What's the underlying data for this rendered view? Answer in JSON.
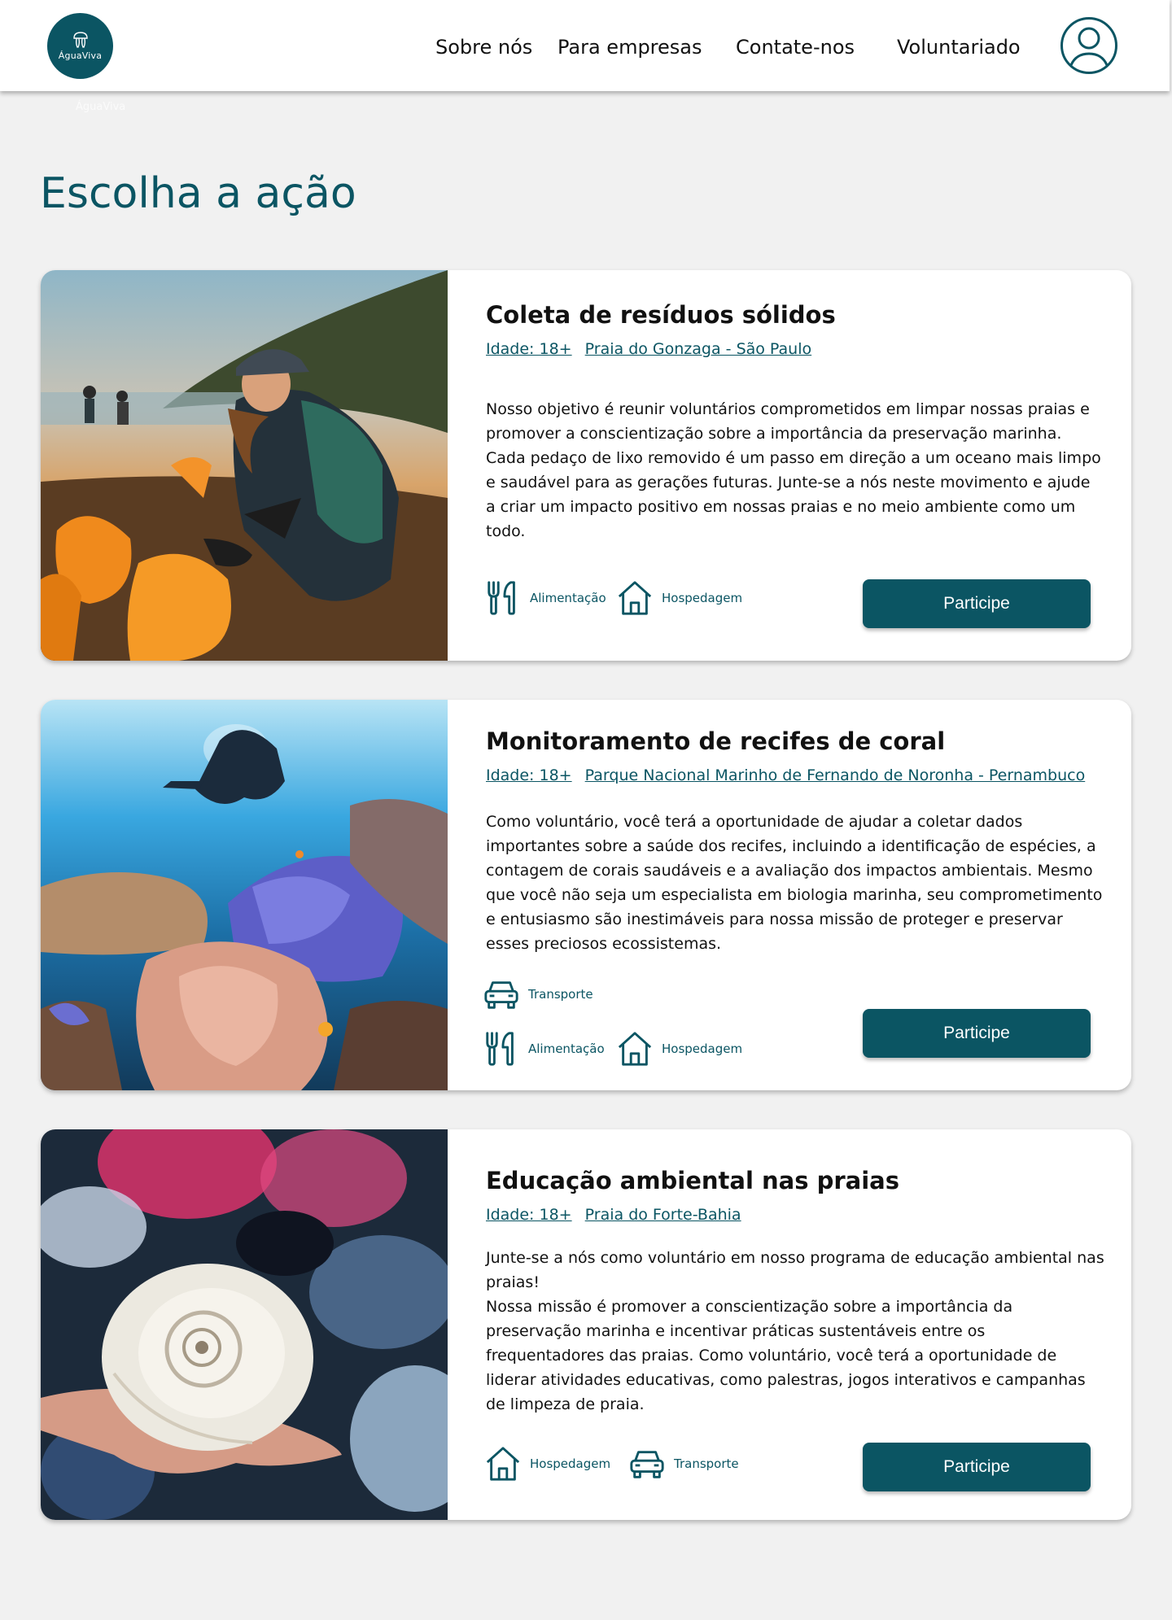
{
  "header": {
    "logo_text": "ÁguaViva",
    "logo_ghost_text": "ÁguaViva",
    "nav": [
      {
        "label": "Sobre nós"
      },
      {
        "label": "Para empresas"
      },
      {
        "label": "Contate-nos"
      },
      {
        "label": "Voluntariado"
      }
    ],
    "account_icon": "user-circle-icon"
  },
  "page_title": "Escolha a ação",
  "colors": {
    "primary": "#0b5563",
    "background": "#f1f1f1",
    "card": "#ffffff"
  },
  "actions": [
    {
      "title": "Coleta de resíduos sólidos",
      "age": "Idade: 18+",
      "location": "Praia do Gonzaga - São Paulo",
      "description": "Nosso objetivo é reunir voluntários comprometidos em limpar nossas praias e promover a conscientização sobre a importância da preservação marinha. Cada pedaço de lixo removido é um passo em direção a um oceano mais limpo e saudável para as gerações futuras. Junte-se a nós neste movimento e ajude a criar um impacto positivo em nossas praias e no meio ambiente como um todo.",
      "image": "photo-beach-cleanup",
      "amenities": [
        {
          "label": "Alimentação",
          "icon": "fork-knife-icon"
        },
        {
          "label": "Hospedagem",
          "icon": "house-icon"
        }
      ],
      "button_label": "Participe"
    },
    {
      "title": "Monitoramento de recifes de coral",
      "age": "Idade: 18+",
      "location": "Parque Nacional Marinho de Fernando de Noronha - Pernambuco",
      "description": "Como voluntário, você terá a oportunidade de ajudar a coletar dados importantes sobre a saúde dos recifes, incluindo a identificação de espécies, a contagem de corais saudáveis e a avaliação dos impactos ambientais. Mesmo que você não seja um especialista em biologia marinha, seu comprometimento e entusiasmo são inestimáveis para nossa missão de proteger e preservar esses preciosos ecossistemas.",
      "image": "photo-coral-reef-diver",
      "amenities": [
        {
          "label": "Transporte",
          "icon": "car-icon"
        },
        {
          "label": "Alimentação",
          "icon": "fork-knife-icon"
        },
        {
          "label": "Hospedagem",
          "icon": "house-icon"
        }
      ],
      "button_label": "Participe"
    },
    {
      "title": "Educação ambiental nas praias",
      "age": "Idade: 18+",
      "location": "Praia do Forte-Bahia",
      "description": "Junte-se a nós como voluntário em nosso programa de educação ambiental nas praias!\nNossa missão é promover a conscientização sobre a importância da preservação marinha e incentivar práticas sustentáveis entre os frequentadores das praias. Como voluntário, você terá a oportunidade de liderar atividades educativas, como palestras, jogos interativos e campanhas de limpeza de praia.",
      "image": "photo-seashell-in-hand",
      "amenities": [
        {
          "label": "Hospedagem",
          "icon": "house-icon"
        },
        {
          "label": "Transporte",
          "icon": "car-icon"
        }
      ],
      "button_label": "Participe"
    }
  ]
}
